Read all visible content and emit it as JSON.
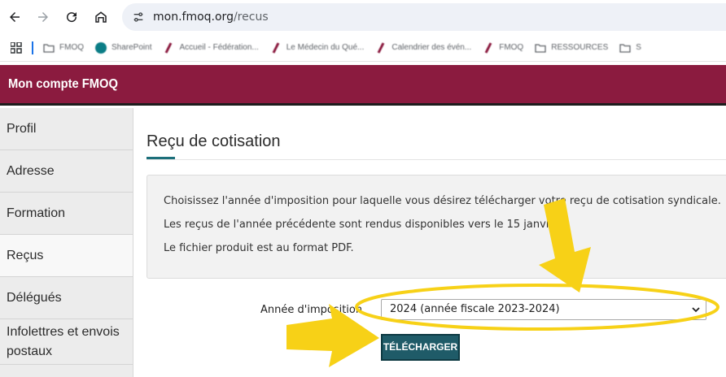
{
  "browser": {
    "url_domain": "mon.fmoq.org",
    "url_path": "/recus"
  },
  "bookmarks": [
    {
      "label": "FMOQ",
      "icon": "folder-icon"
    },
    {
      "label": "SharePoint",
      "icon": "sharepoint-icon"
    },
    {
      "label": "Accueil - Fédération...",
      "icon": "fmoq-logo-icon"
    },
    {
      "label": "Le Médecin du Qué...",
      "icon": "fmoq-logo-icon"
    },
    {
      "label": "Calendrier des évén...",
      "icon": "fmoq-logo-icon"
    },
    {
      "label": "FMOQ",
      "icon": "fmoq-logo-icon"
    },
    {
      "label": "RESSOURCES",
      "icon": "folder-icon"
    },
    {
      "label": "S",
      "icon": "folder-icon"
    }
  ],
  "header": {
    "title": "Mon compte FMOQ"
  },
  "sidebar": {
    "items": [
      {
        "label": "Profil"
      },
      {
        "label": "Adresse"
      },
      {
        "label": "Formation"
      },
      {
        "label": "Reçus"
      },
      {
        "label": "Délégués"
      },
      {
        "label": "Infolettres et envois postaux"
      }
    ]
  },
  "main": {
    "title": "Reçu de cotisation",
    "info_lines": [
      "Choisissez l'année d'imposition pour laquelle vous désirez télécharger votre reçu de cotisation syndicale.",
      "Les reçus de l'année précédente sont rendus disponibles vers le 15 janvier.",
      "Le fichier produit est au format PDF."
    ],
    "form": {
      "label": "Année d'imposition",
      "selected_value": "2024 (année fiscale 2023-2024)",
      "download_label": "TÉLÉCHARGER"
    }
  },
  "colors": {
    "header_bg": "#8b1b3f",
    "accent": "#1f5b68",
    "annotation": "#f7d117"
  }
}
